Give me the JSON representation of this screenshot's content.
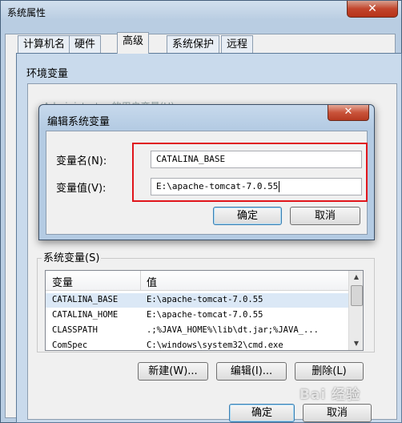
{
  "system_properties": {
    "title": "系统属性",
    "close_glyph": "✕",
    "tabs": [
      "计算机名",
      "硬件",
      "高级",
      "系统保护",
      "远程"
    ]
  },
  "env_window": {
    "title": "环境变量",
    "user_vars_label": "Administrator 的用户变量(U)",
    "system_vars_label": "系统变量(S)",
    "columns": [
      "变量",
      "值"
    ],
    "rows": [
      {
        "name": "CATALINA_BASE",
        "value": "E:\\apache-tomcat-7.0.55",
        "selected": true
      },
      {
        "name": "CATALINA_HOME",
        "value": "E:\\apache-tomcat-7.0.55",
        "selected": false
      },
      {
        "name": "CLASSPATH",
        "value": ".;%JAVA_HOME%\\lib\\dt.jar;%JAVA_...",
        "selected": false
      },
      {
        "name": "ComSpec",
        "value": "C:\\windows\\system32\\cmd.exe",
        "selected": false
      }
    ],
    "buttons": {
      "new": "新建(W)...",
      "edit": "编辑(I)...",
      "delete": "删除(L)"
    },
    "ok": "确定",
    "cancel": "取消"
  },
  "edit_dialog": {
    "title": "编辑系统变量",
    "close_glyph": "✕",
    "name_label": "变量名(N):",
    "value_label": "变量值(V):",
    "name_value": "CATALINA_BASE",
    "value_value": "E:\\apache-tomcat-7.0.55",
    "ok": "确定",
    "cancel": "取消"
  },
  "watermark": "Bai 经验"
}
